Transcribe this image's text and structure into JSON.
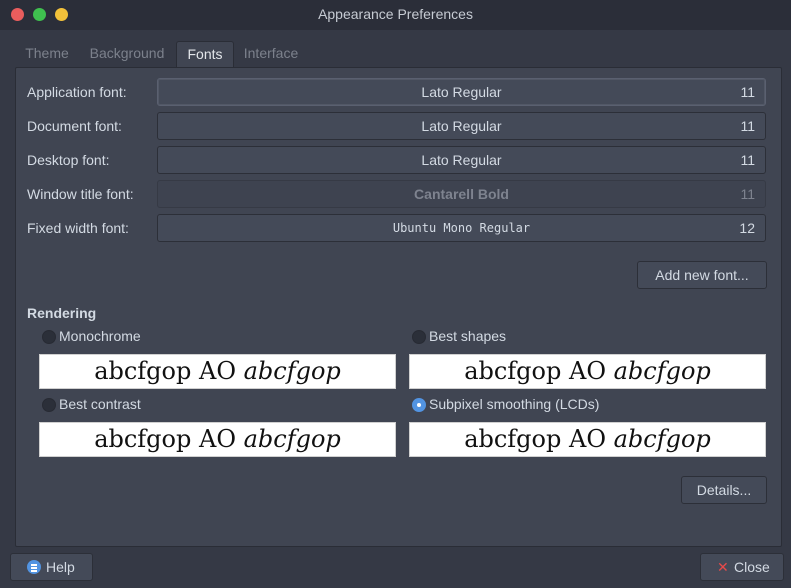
{
  "window": {
    "title": "Appearance Preferences"
  },
  "tabs": [
    {
      "label": "Theme",
      "active": false
    },
    {
      "label": "Background",
      "active": false
    },
    {
      "label": "Fonts",
      "active": true
    },
    {
      "label": "Interface",
      "active": false
    }
  ],
  "fonts": [
    {
      "label": "Application font:",
      "font": "Lato Regular",
      "size": "11",
      "enabled": true
    },
    {
      "label": "Document font:",
      "font": "Lato Regular",
      "size": "11",
      "enabled": true
    },
    {
      "label": "Desktop font:",
      "font": "Lato Regular",
      "size": "11",
      "enabled": true
    },
    {
      "label": "Window title font:",
      "font": "Cantarell Bold",
      "size": "11",
      "enabled": false
    },
    {
      "label": "Fixed width font:",
      "font": "Ubuntu Mono Regular",
      "size": "12",
      "enabled": true
    }
  ],
  "add_font_button": "Add new font...",
  "rendering": {
    "title": "Rendering",
    "options": [
      {
        "label": "Monochrome",
        "checked": false
      },
      {
        "label": "Best shapes",
        "checked": false
      },
      {
        "label": "Best contrast",
        "checked": false
      },
      {
        "label": "Subpixel smoothing (LCDs)",
        "checked": true
      }
    ],
    "sample_regular": "abcfgop AO ",
    "sample_italic": "abcfgop"
  },
  "details_button": "Details...",
  "footer": {
    "help": "Help",
    "close": "Close"
  },
  "colors": {
    "accent": "#5294e2",
    "close_icon": "#e84a4a"
  }
}
